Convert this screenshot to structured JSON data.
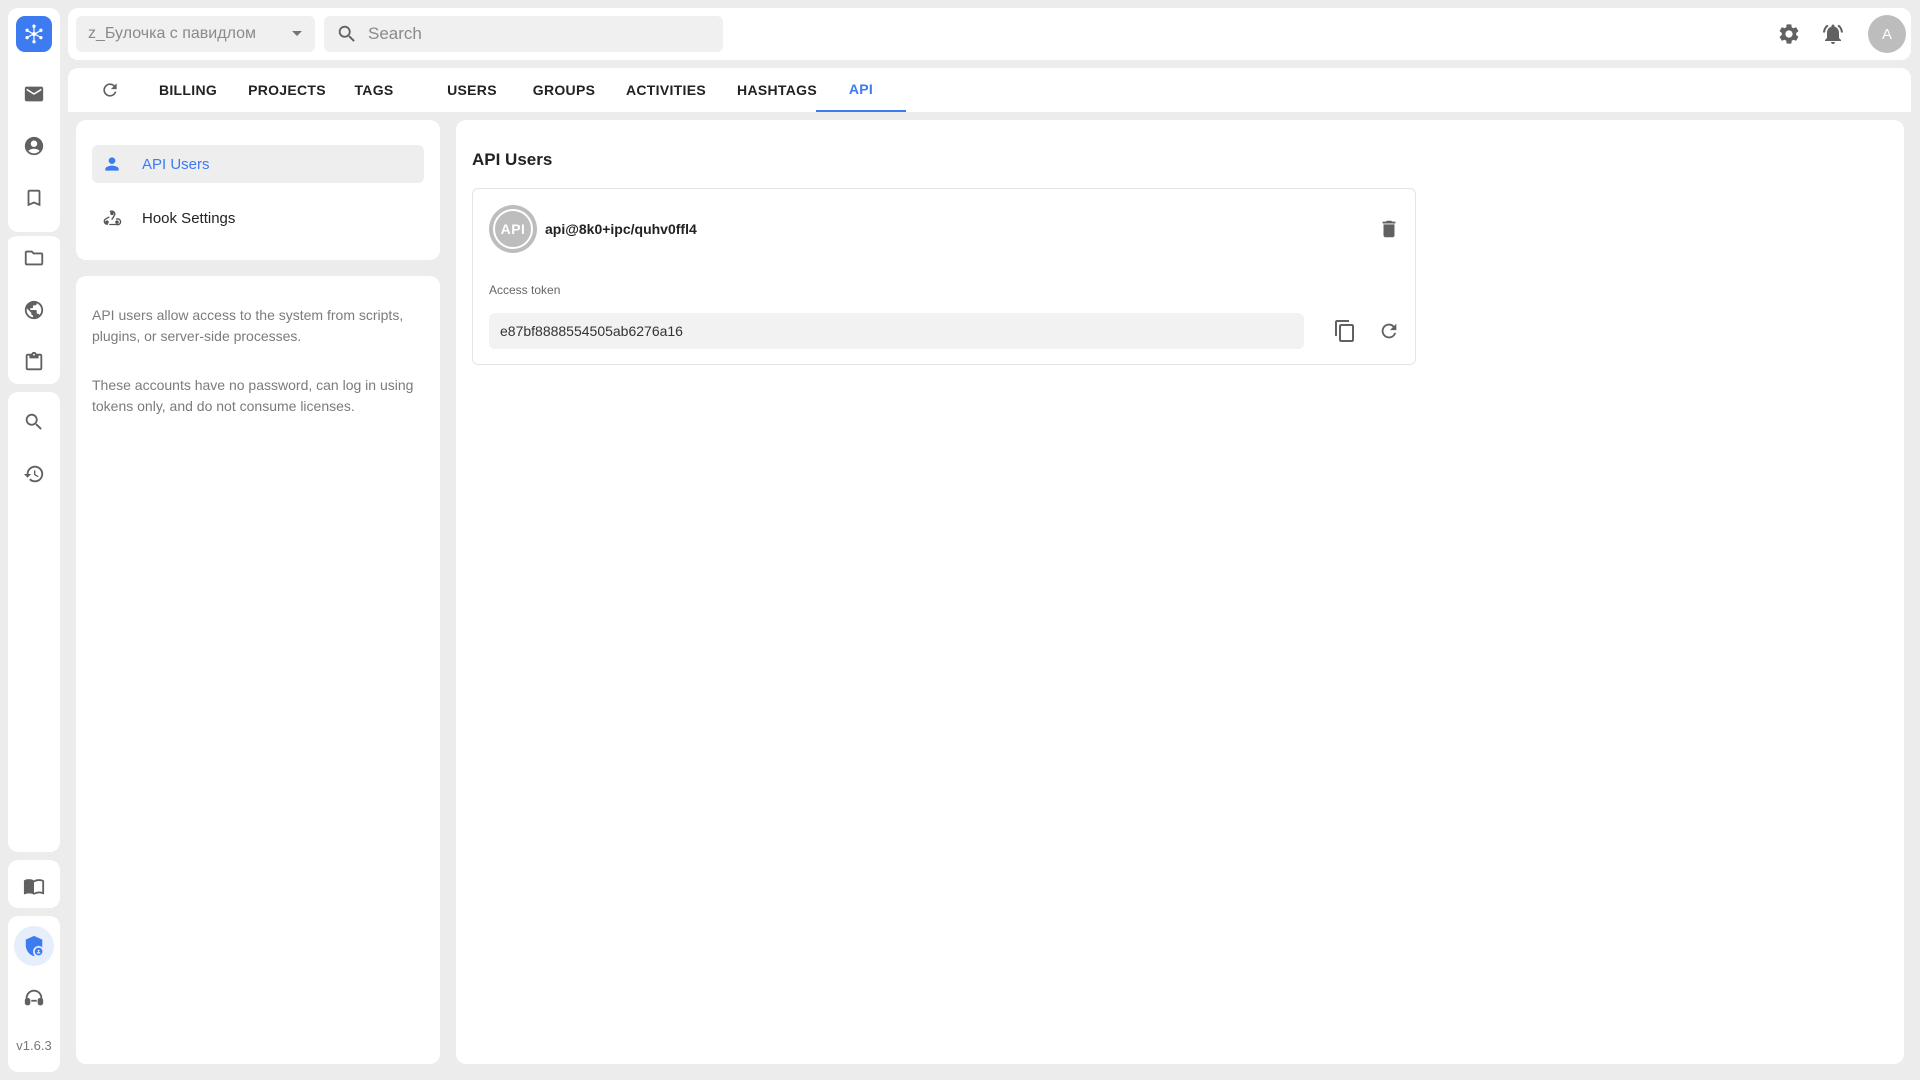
{
  "topbar": {
    "project_selector": "z_Булочка с павидлом",
    "search_placeholder": "Search",
    "avatar_initial": "A"
  },
  "tabs": [
    {
      "label": "BILLING"
    },
    {
      "label": "PROJECTS"
    },
    {
      "label": "TAGS"
    },
    {
      "label": "USERS"
    },
    {
      "label": "GROUPS"
    },
    {
      "label": "ACTIVITIES"
    },
    {
      "label": "HASHTAGS"
    },
    {
      "label": "API",
      "active": true
    }
  ],
  "side_nav": {
    "items": [
      {
        "label": "API Users",
        "icon": "person-icon",
        "active": true
      },
      {
        "label": "Hook Settings",
        "icon": "webhook-icon"
      }
    ]
  },
  "info": {
    "p1": "API users allow access to the system from scripts, plugins, or server-side processes.",
    "p2": "These accounts have no password, can log in using tokens only, and do not consume licenses."
  },
  "main": {
    "title": "API Users",
    "users": [
      {
        "avatar_text": "API",
        "login": "api@8k0+ipc/quhv0ffl4",
        "token_label": "Access token",
        "token": "e87bf8888554505ab6276a16"
      }
    ]
  },
  "rail": {
    "version": "v1.6.3",
    "icons": [
      "logo-icon",
      "mail-icon",
      "account-icon",
      "bookmark-icon",
      "folder-icon",
      "globe-icon",
      "clipboard-icon",
      "search-icon",
      "history-icon",
      "book-icon",
      "admin-shield-icon",
      "support-icon"
    ]
  },
  "colors": {
    "accent": "#3d7bf0",
    "background": "#ececec",
    "panel": "#ffffff",
    "icon_gray": "#616161",
    "muted_text": "#7b7b7b"
  }
}
